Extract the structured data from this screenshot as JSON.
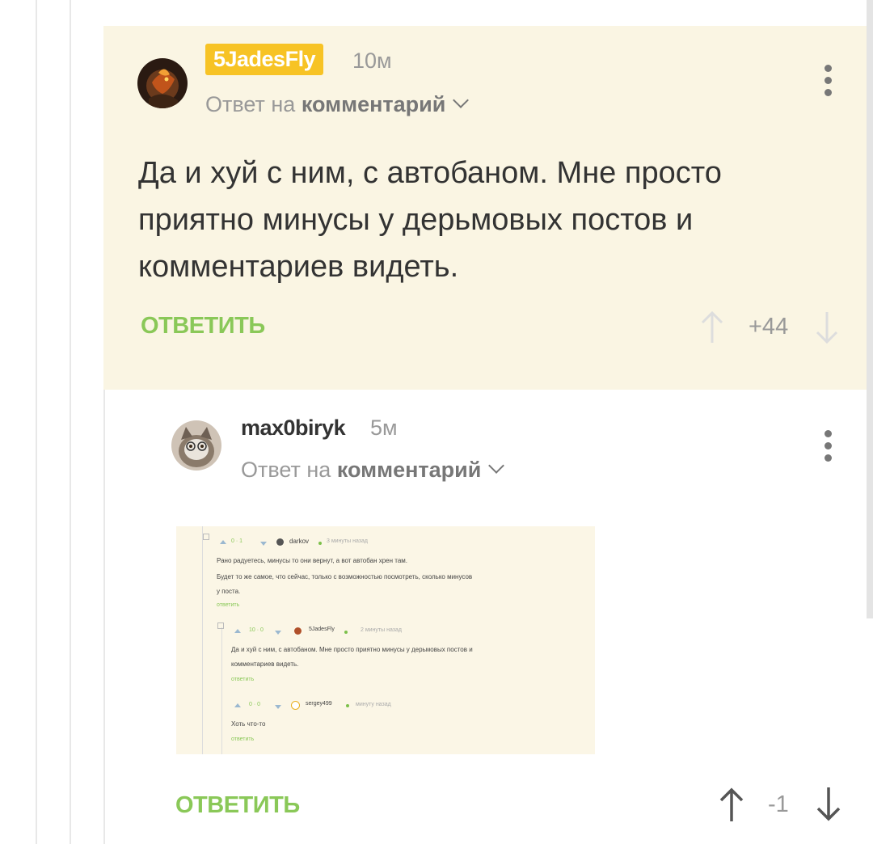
{
  "comments": [
    {
      "username": "5JadesFly",
      "time": "10м",
      "reply_prefix": "Ответ на",
      "reply_target": "комментарий",
      "text": "Да и хуй с ним, с автобаном. Мне просто приятно минусы у дерьмовых постов и комментариев видеть.",
      "reply_label": "ОТВЕТИТЬ",
      "rating": "+44"
    },
    {
      "username": "max0biryk",
      "time": "5м",
      "reply_prefix": "Ответ на",
      "reply_target": "комментарий",
      "reply_label": "ОТВЕТИТЬ",
      "rating": "-1"
    }
  ],
  "embedded_screenshot": {
    "c1": {
      "rating": "0 · 1",
      "user": "darkov",
      "time": "3 минуты назад",
      "line1": "Рано радуетесь, минусы то они вернут, а вот автобан хрен там.",
      "line2": "Будет то же самое, что сейчас, только с возможностью посмотреть, сколько минусов",
      "line3": "у поста.",
      "reply": "ответить"
    },
    "c2": {
      "rating": "10 · 0",
      "user": "5JadesFly",
      "time": "2 минуты назад",
      "line1": "Да и хуй с ним, с автобаном. Мне просто приятно минусы у дерьмовых постов и",
      "line2": "комментариев видеть.",
      "reply": "ответить"
    },
    "c3": {
      "rating": "0 · 0",
      "user": "sergey499",
      "time": "минуту назад",
      "line1": "Хоть что-то",
      "reply": "ответить"
    }
  },
  "colors": {
    "highlight_bg": "#faf5e3",
    "badge": "#f7c325",
    "reply_green": "#8ac858",
    "muted": "#999999"
  },
  "icons": [
    "vertical-dots-icon",
    "chevron-down-icon",
    "arrow-up-icon",
    "arrow-down-icon"
  ]
}
